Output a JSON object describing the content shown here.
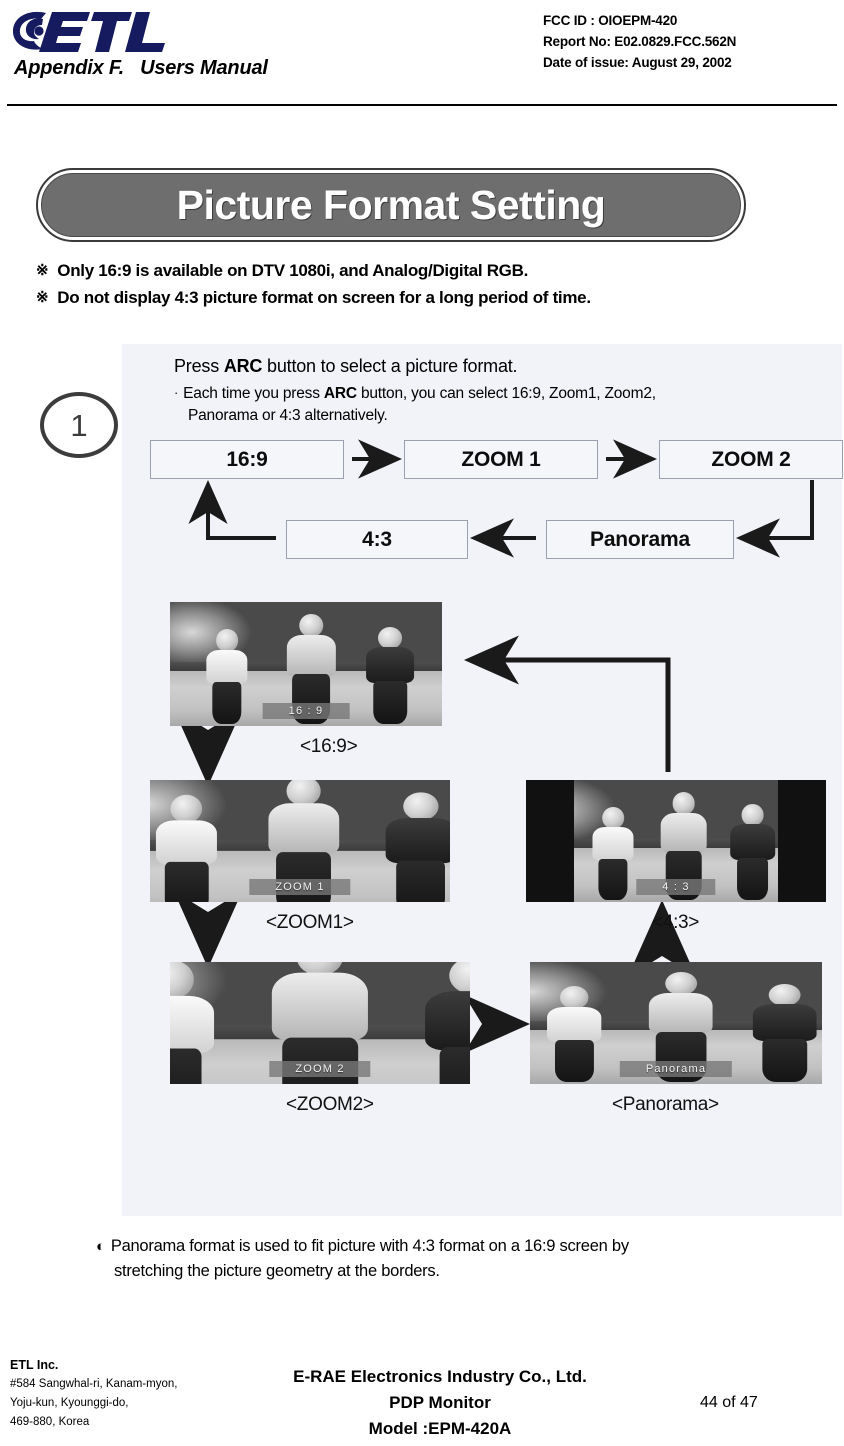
{
  "header": {
    "logo_text": "ETL",
    "logo_icon": "etl-swirl-logo",
    "appendix": "Appendix F.   Users Manual",
    "fcc_id": "FCC ID : OIOEPM-420",
    "report_no": "Report No: E02.0829.FCC.562N",
    "date_of_issue": "Date of issue: August 29, 2002"
  },
  "title": {
    "banner": "Picture Format Setting"
  },
  "notes": [
    {
      "mark": "※",
      "text": "Only 16:9 is available on DTV 1080i, and Analog/Digital RGB."
    },
    {
      "mark": "※",
      "text": "Do not display 4:3 picture format on screen for a long period of time."
    }
  ],
  "step": {
    "number": "1",
    "heading_before": "Press ",
    "heading_bold": "ARC",
    "heading_after": " button to select a picture format.",
    "bullet_dot": "·",
    "bullet_before": "Each time you press ",
    "bullet_bold": "ARC",
    "bullet_after": " button, you can select 16:9, Zoom1,  Zoom2,",
    "bullet_line2": "Panorama or 4:3 alternatively."
  },
  "flow": {
    "boxes": [
      {
        "id": "box-169",
        "label": "16:9"
      },
      {
        "id": "box-zoom1",
        "label": "ZOOM 1"
      },
      {
        "id": "box-zoom2",
        "label": "ZOOM 2"
      },
      {
        "id": "box-43",
        "label": "4:3"
      },
      {
        "id": "box-pano",
        "label": "Panorama"
      }
    ],
    "sequence": "16:9 → ZOOM 1 → ZOOM 2 → Panorama → 4:3 → 16:9"
  },
  "photos": [
    {
      "id": "shot-169",
      "osd": "16 : 9",
      "caption": "<16:9>",
      "pillarbox": false
    },
    {
      "id": "shot-zoom1",
      "osd": "ZOOM 1",
      "caption": "<ZOOM1>",
      "pillarbox": false
    },
    {
      "id": "shot-43",
      "osd": "4 : 3",
      "caption": "<4:3>",
      "pillarbox": true
    },
    {
      "id": "shot-zoom2",
      "osd": "ZOOM 2",
      "caption": "<ZOOM2>",
      "pillarbox": false
    },
    {
      "id": "shot-pano",
      "osd": "Panorama",
      "caption": "<Panorama>",
      "pillarbox": false
    }
  ],
  "bottom_note": {
    "mark": "◐",
    "line1": "Panorama format is used to fit picture with 4:3 format on a 16:9 screen by",
    "line2": "stretching the picture geometry at the borders."
  },
  "footer": {
    "company": "ETL Inc.",
    "address": [
      "#584 Sangwhal-ri, Kanam-myon,",
      "Yoju-kun, Kyounggi-do,",
      "469-880, Korea"
    ],
    "center": [
      "E-RAE Electronics Industry Co., Ltd.",
      "PDP Monitor",
      "Model :EPM-420A"
    ],
    "page": "44 of 47"
  },
  "colors": {
    "logo_navy": "#151b5e",
    "pill_fill": "#6e6e6e",
    "pill_border": "#3a3a3a",
    "panel_bg": "#f1f3f8",
    "rule": "#000000"
  }
}
